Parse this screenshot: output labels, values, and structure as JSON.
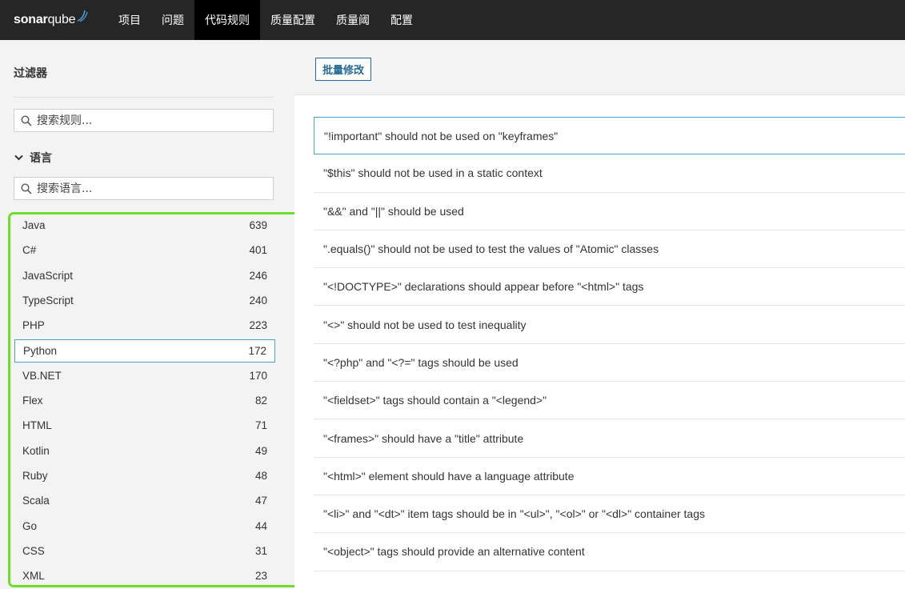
{
  "nav": {
    "logo_bold": "sonar",
    "logo_rest": "qube",
    "items": [
      {
        "label": "项目",
        "active": false
      },
      {
        "label": "问题",
        "active": false
      },
      {
        "label": "代码规则",
        "active": true
      },
      {
        "label": "质量配置",
        "active": false
      },
      {
        "label": "质量阈",
        "active": false
      },
      {
        "label": "配置",
        "active": false
      }
    ]
  },
  "sidebar": {
    "title": "过滤器",
    "rule_search_placeholder": "搜索规则...",
    "language_facet": "语言",
    "language_search_placeholder": "搜索语言...",
    "languages": [
      {
        "name": "Java",
        "count": "639"
      },
      {
        "name": "C#",
        "count": "401"
      },
      {
        "name": "JavaScript",
        "count": "246"
      },
      {
        "name": "TypeScript",
        "count": "240"
      },
      {
        "name": "PHP",
        "count": "223"
      },
      {
        "name": "Python",
        "count": "172",
        "selected": true
      },
      {
        "name": "VB.NET",
        "count": "170"
      },
      {
        "name": "Flex",
        "count": "82"
      },
      {
        "name": "HTML",
        "count": "71"
      },
      {
        "name": "Kotlin",
        "count": "49"
      },
      {
        "name": "Ruby",
        "count": "48"
      },
      {
        "name": "Scala",
        "count": "47"
      },
      {
        "name": "Go",
        "count": "44"
      },
      {
        "name": "CSS",
        "count": "31"
      },
      {
        "name": "XML",
        "count": "23"
      }
    ]
  },
  "main": {
    "bulk_change_label": "批量修改",
    "rules": [
      "\"!important\" should not be used on \"keyframes\"",
      "\"$this\" should not be used in a static context",
      "\"&&\" and \"||\" should be used",
      "\".equals()\" should not be used to test the values of \"Atomic\" classes",
      "\"<!DOCTYPE>\" declarations should appear before \"<html>\" tags",
      "\"<>\" should not be used to test inequality",
      "\"<?php\" and \"<?=\" tags should be used",
      "\"<fieldset>\" tags should contain a \"<legend>\"",
      "\"<frames>\" should have a \"title\" attribute",
      "\"<html>\" element should have a language attribute",
      "\"<li>\" and \"<dt>\" item tags should be in \"<ul>\", \"<ol>\" or \"<dl>\" container tags",
      "\"<object>\" tags should provide an alternative content"
    ]
  },
  "colors": {
    "nav_bg": "#262626",
    "highlight_border": "#6ddf2a",
    "selected_border": "#4b9fd5",
    "link_blue": "#236a97"
  }
}
